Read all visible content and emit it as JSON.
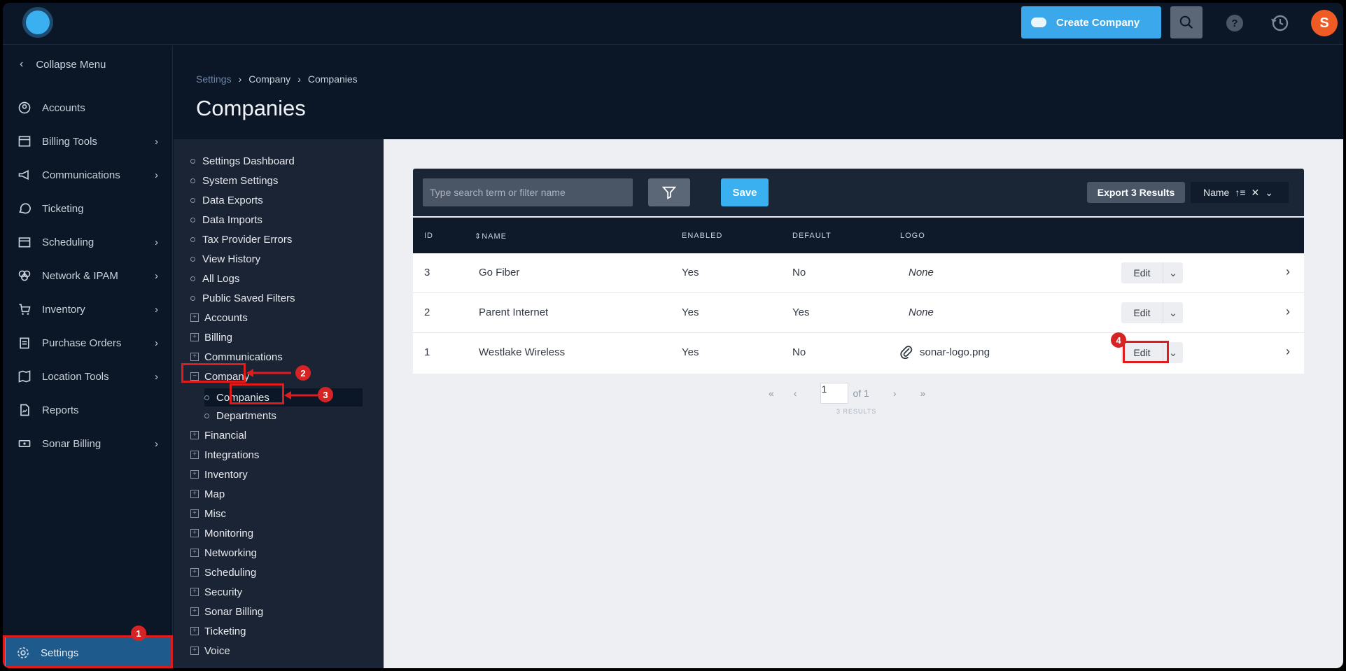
{
  "topbar": {
    "create_label": "Create Company",
    "avatar_letter": "S"
  },
  "leftnav": {
    "collapse_label": "Collapse Menu",
    "items": [
      {
        "label": "Accounts",
        "icon": "user-circle-icon",
        "has_arrow": false
      },
      {
        "label": "Billing Tools",
        "icon": "calculator-icon",
        "has_arrow": true
      },
      {
        "label": "Communications",
        "icon": "megaphone-icon",
        "has_arrow": true
      },
      {
        "label": "Ticketing",
        "icon": "chat-bubble-icon",
        "has_arrow": false
      },
      {
        "label": "Scheduling",
        "icon": "calendar-icon",
        "has_arrow": true
      },
      {
        "label": "Network & IPAM",
        "icon": "network-icon",
        "has_arrow": true
      },
      {
        "label": "Inventory",
        "icon": "cart-icon",
        "has_arrow": true
      },
      {
        "label": "Purchase Orders",
        "icon": "clipboard-icon",
        "has_arrow": true
      },
      {
        "label": "Location Tools",
        "icon": "map-icon",
        "has_arrow": true
      },
      {
        "label": "Reports",
        "icon": "report-icon",
        "has_arrow": false
      },
      {
        "label": "Sonar Billing",
        "icon": "money-icon",
        "has_arrow": true
      }
    ],
    "settings_label": "Settings"
  },
  "header": {
    "breadcrumb": [
      "Settings",
      "Company",
      "Companies"
    ],
    "title": "Companies"
  },
  "tree": {
    "top_items": [
      "Settings Dashboard",
      "System Settings",
      "Data Exports",
      "Data Imports",
      "Tax Provider Errors",
      "View History",
      "All Logs",
      "Public Saved Filters"
    ],
    "groups_before": [
      "Accounts",
      "Billing",
      "Communications"
    ],
    "open_group": "Company",
    "open_children": [
      "Companies",
      "Departments"
    ],
    "groups_after": [
      "Financial",
      "Integrations",
      "Inventory",
      "Map",
      "Misc",
      "Monitoring",
      "Networking",
      "Scheduling",
      "Security",
      "Sonar Billing",
      "Ticketing",
      "Voice"
    ]
  },
  "toolbar": {
    "search_placeholder": "Type search term or filter name",
    "save_label": "Save",
    "export_label": "Export 3 Results",
    "sort_label": "Name"
  },
  "table": {
    "columns": [
      "ID",
      "NAME",
      "ENABLED",
      "DEFAULT",
      "LOGO"
    ],
    "rows": [
      {
        "id": "3",
        "name": "Go Fiber",
        "enabled": "Yes",
        "default": "No",
        "logo": "None"
      },
      {
        "id": "2",
        "name": "Parent Internet",
        "enabled": "Yes",
        "default": "Yes",
        "logo": "None"
      },
      {
        "id": "1",
        "name": "Westlake Wireless",
        "enabled": "Yes",
        "default": "No",
        "logo": "sonar-logo.png"
      }
    ],
    "edit_label": "Edit"
  },
  "pager": {
    "page": "1",
    "of_label": "of 1",
    "results_label": "3 RESULTS"
  },
  "annotations": [
    "1",
    "2",
    "3",
    "4"
  ],
  "colors": {
    "accent": "#3aa8ea",
    "highlight": "#e01b1b",
    "avatar": "#f05a24"
  }
}
